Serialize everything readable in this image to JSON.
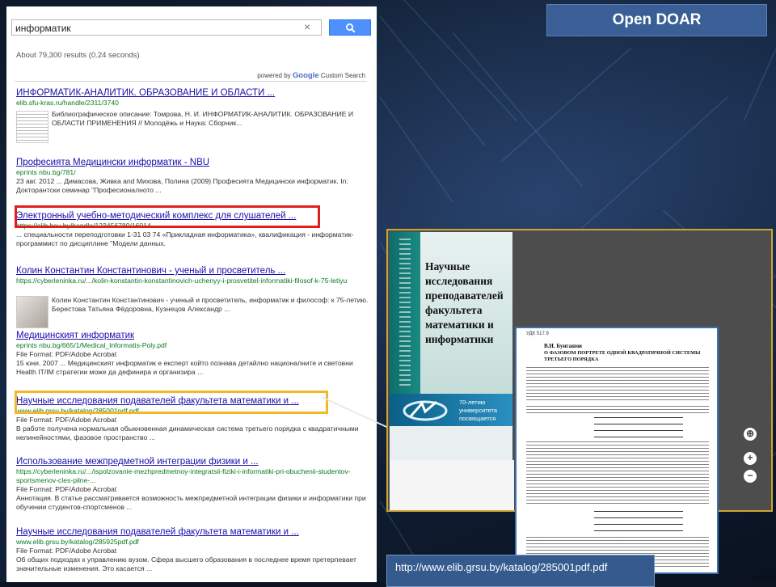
{
  "slide": {
    "title": "Open DOAR",
    "url_caption": "http://www.elib.grsu.by/katalog/285001pdf.pdf"
  },
  "search": {
    "query": "информатик",
    "clear_label": "×",
    "stats": "About 79,300 results (0.24 seconds)",
    "powered_prefix": "powered by",
    "powered_brand": "Google",
    "powered_suffix": "Custom Search"
  },
  "results": [
    {
      "title": "ИНФОРМАТИК-АНАЛИТИК. ОБРАЗОВАНИЕ И ОБЛАСТИ ...",
      "url": "elib.sfu-kras.ru/handle/2311/3740",
      "snippet": "Библиографическое описание: Томрова, Н. И. ИНФОРМАТИК-АНАЛИТИК. ОБРАЗОВАНИЕ И ОБЛАСТИ ПРИМЕНЕНИЯ // Молодёжь и Наука: Сборник..."
    },
    {
      "title": "Професията Медицински информатик - NBU",
      "url": "eprints nbu.bg/781/",
      "snippet": "23 авг. 2012 ... Димасова, Живка and Михова, Полина (2009) Професията Медицински информатик. In: Докторантски семинар \"Професионалното ..."
    },
    {
      "title": "Электронный учебно-методический комплекс для слушателей ...",
      "url": "https://elib.bsu.by/handle/123456789/16014",
      "snippet": "... специальности переподготовки 1-31 03 74 «Прикладная информатика», квалификация - информатик-программист по дисциплине \"Модели данных."
    },
    {
      "title": "Колин Константин Константинович - ученый и просветитель ...",
      "url": "https://cyberleninka.ru/.../kolin-konstantin-konstantinovich-uchenyy-i-prosvetitel-informatiki-filosof-k-75-letiyu",
      "snippet": "Колин Константин Константинович - ученый и просветитель, информатик и философ: к 75-летию. Берестова Татьяна Фёдоровна, Кузнецов Александр ..."
    },
    {
      "title": "Медицинският информатик",
      "url": "eprints nbu.bg/665/1/Medical_Informatis-Poly.pdf",
      "format": "File Format: PDF/Adobe Acrobat",
      "snippet": "15 юни. 2007 ... Медицинският информатик е експерт който познава детайлно националните и световни Health IT/IM стратегии може да дефинира и организира ..."
    },
    {
      "title": "Научные исследования подавателей факультета математики и ...",
      "url": "www.elib.grsu.by/katalog/285001pdf.pdf",
      "format": "File Format: PDF/Adobe Acrobat",
      "snippet": "В работе получена нормальная обыкновенная динамическая система третьего порядка с квадратичными нелинейностями, фазовое пространство ..."
    },
    {
      "title": "Использование межпредметной интеграции физики и ...",
      "url": "https://cyberleninka.ru/.../ispolzovanie-mezhpredmetnoy-integratsii-fiziki-i-informatiki-pri-obuchenii-studentov-sportsmenov-cles-pilne-...",
      "format": "File Format: PDF/Adobe Acrobat",
      "snippet": "Аннотация. В статье рассматривается возможность межпредметной интеграции физики и информатики при обучении студентов-спортсменов ..."
    },
    {
      "title": "Научные исследования подавателей факультета математики и ...",
      "url": "www.elib.grsu.by/katalog/285925pdf.pdf",
      "format": "File Format: PDF/Adobe Acrobat",
      "snippet": "Об общих подходах к управлению вузом. Сфера высшего образования в последнее время претерпевает значительные изменения. Это касается ..."
    }
  ],
  "viewer": {
    "cover_title": "Научные исследования преподавателей факультета математики и информатики",
    "cover_subtitle": "70-летию университета посвящается",
    "zoom_reset": "⊕",
    "zoom_in": "+",
    "zoom_out": "−"
  },
  "article": {
    "header": "УДК 517.9",
    "author": "В.И. Бунгашов",
    "title": "О ФАЗОВОМ ПОРТРЕТЕ ОДНОЙ КВАДРАТИЧНОЙ СИСТЕМЫ ТРЕТЬЕГО ПОРЯДКА"
  },
  "colors": {
    "link": "#1a0dab",
    "url_green": "#0a7a22",
    "highlight_red": "#e0201e",
    "highlight_yellow": "#f0b928",
    "search_button": "#4d90fe",
    "title_badge": "#3a5f96"
  },
  "icons": {
    "search_button": "magnifier-icon",
    "clear": "close-icon"
  }
}
